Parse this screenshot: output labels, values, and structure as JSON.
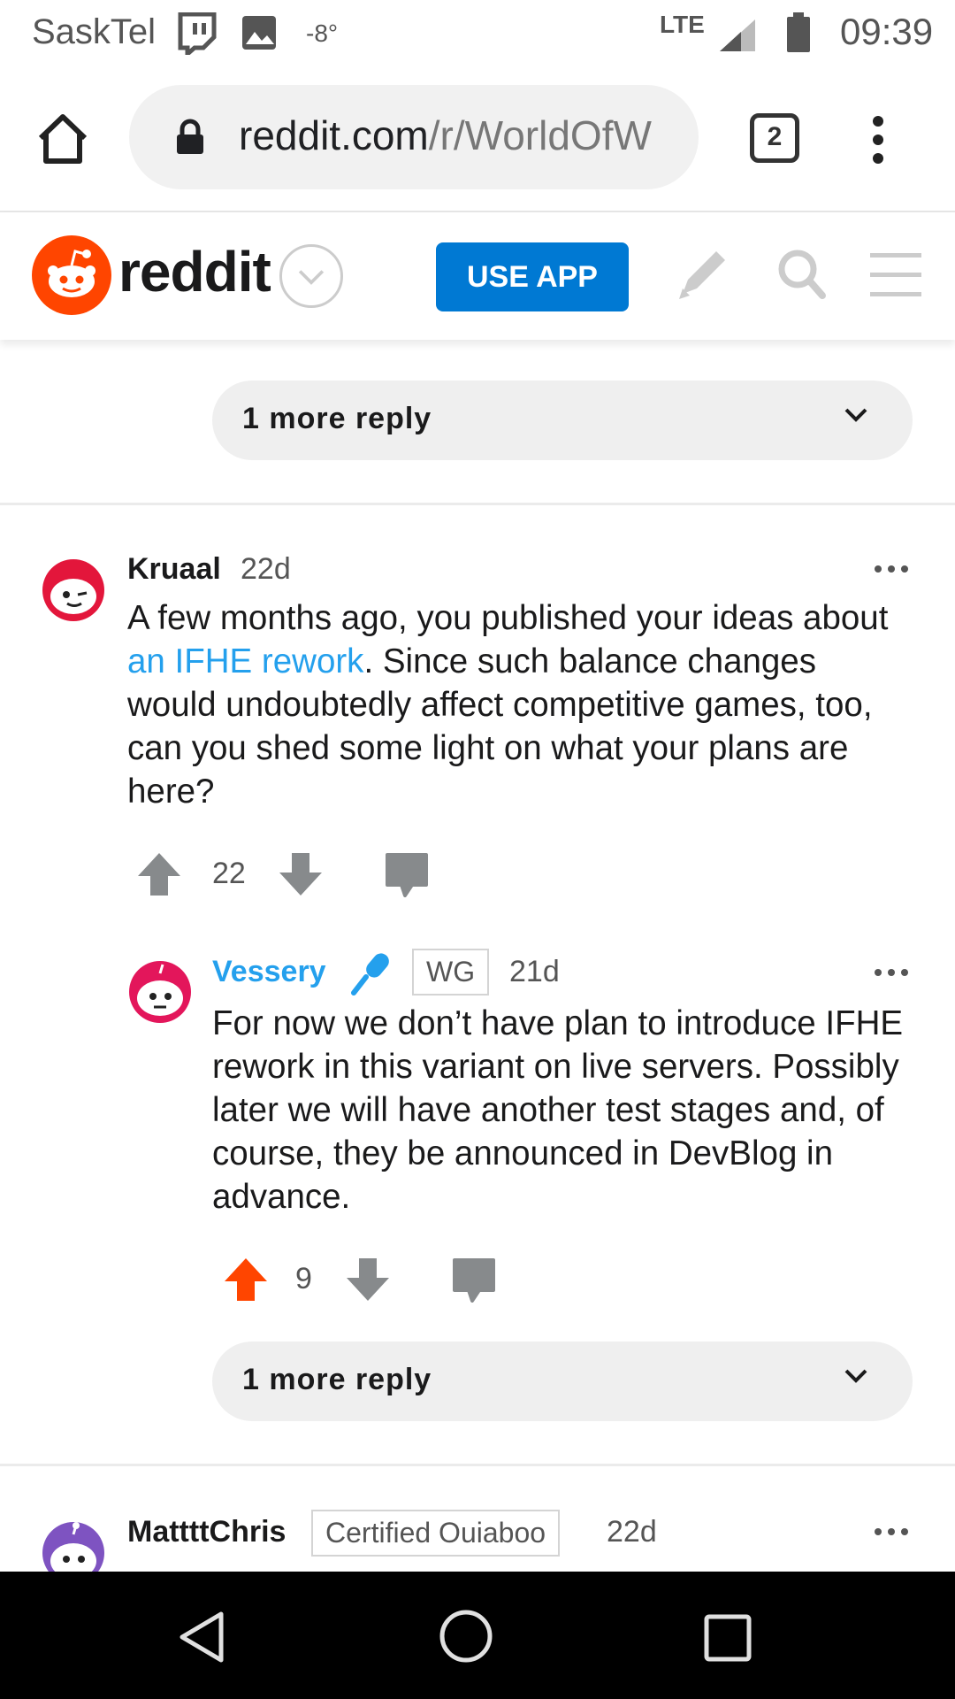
{
  "status_bar": {
    "carrier": "SaskTel",
    "temperature": "-8°",
    "network": "LTE",
    "time": "09:39"
  },
  "browser": {
    "url_host": "reddit.com",
    "url_path": "/r/WorldOfW",
    "tab_count": "2"
  },
  "header": {
    "wordmark": "reddit",
    "use_app": "USE APP",
    "brand_color": "#ff4500",
    "button_color": "#0079d3"
  },
  "more_reply_top": {
    "label": "1 more reply"
  },
  "comments": [
    {
      "username": "Kruaal",
      "age": "22d",
      "body_before": "A few months ago, you published your ideas about ",
      "body_link": "an IFHE rework",
      "body_after": ". Since such balance changes would undoubtedly affect competitive games, too, can you shed some light on what your plans are here?",
      "score": "22"
    },
    {
      "username": "Vessery",
      "flair": "WG",
      "age": "21d",
      "body": "For now we don’t have plan to introduce IFHE rework in this variant on live servers. Possibly later we will have another test stages and, of course, they be announced in DevBlog in advance.",
      "score": "9",
      "upvoted": true,
      "username_color": "#24a0ed",
      "upvote_color": "#ff4500"
    },
    {
      "username": "MattttChris",
      "flair": "Certified Ouiaboo",
      "age": "22d"
    }
  ],
  "more_reply_nested": {
    "label": "1 more reply"
  }
}
